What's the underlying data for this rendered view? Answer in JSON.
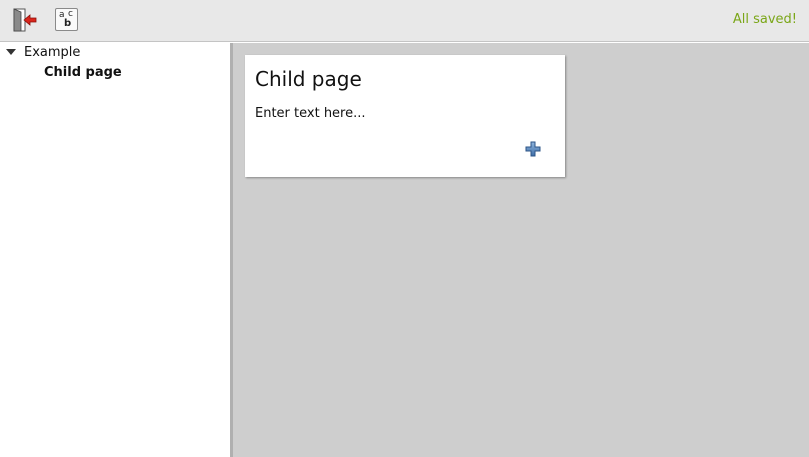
{
  "toolbar": {
    "buttons": [
      {
        "name": "exit",
        "icon": "exit-door-icon"
      },
      {
        "name": "spellcheck",
        "icon": "spellcheck-icon",
        "glyphs": {
          "a": "a",
          "c": "c",
          "b": "b"
        }
      }
    ],
    "status": "All saved!",
    "status_color": "#7aa617"
  },
  "sidebar": {
    "tree": [
      {
        "label": "Example",
        "expanded": true,
        "children": [
          {
            "label": "Child page",
            "selected": true
          }
        ]
      }
    ]
  },
  "workspace": {
    "card": {
      "title": "Child page",
      "placeholder": "Enter text here...",
      "add_icon": "plus-icon"
    }
  }
}
